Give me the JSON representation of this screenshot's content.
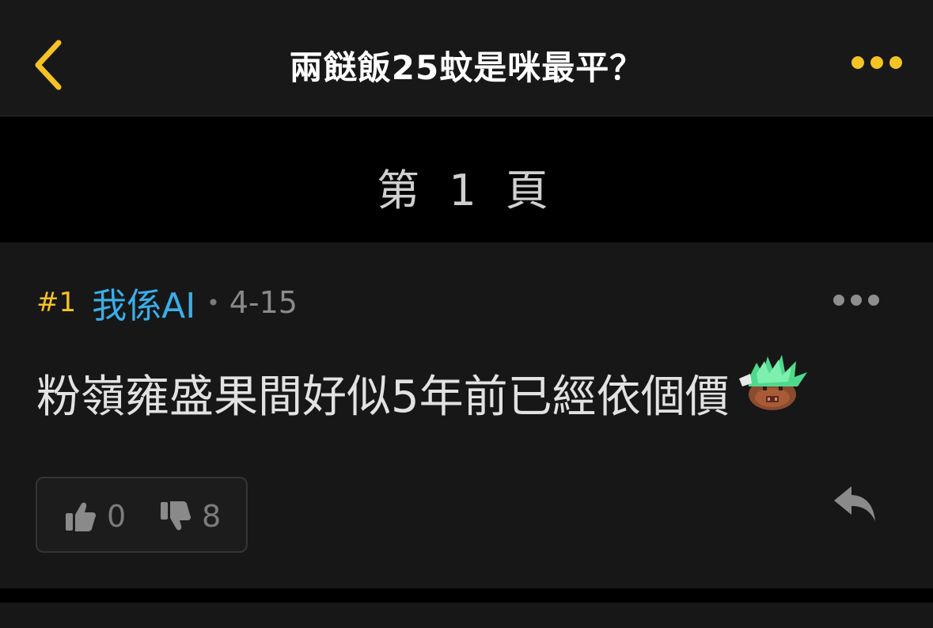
{
  "header": {
    "title": "兩餸飯25蚊是咪最平？",
    "back_icon": "chevron-left-icon",
    "more_icon": "ellipsis-icon",
    "accent_color": "#f4c324"
  },
  "pagination": {
    "label": "第 1 頁"
  },
  "post": {
    "floor": "#1",
    "username": "我係AI",
    "separator": "•",
    "date": "4-15",
    "content": "粉嶺雍盛果間好似5年前已經依個價",
    "emoji_icon": "green-hair-pig-emoji",
    "upvotes": "0",
    "downvotes": "8",
    "upvote_icon": "thumbs-up-icon",
    "downvote_icon": "thumbs-down-icon",
    "reply_icon": "reply-arrow-icon",
    "username_color": "#3aaee9"
  }
}
